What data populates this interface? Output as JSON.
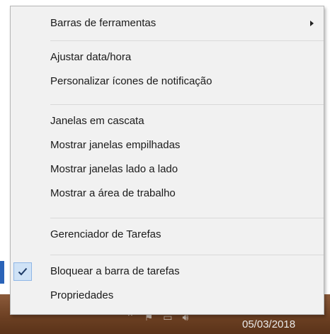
{
  "menu": {
    "items": [
      {
        "label": "Barras de ferramentas",
        "submenu": true
      },
      {
        "label": "Ajustar data/hora"
      },
      {
        "label": "Personalizar ícones de notificação"
      },
      {
        "label": "Janelas em cascata"
      },
      {
        "label": "Mostrar janelas empilhadas"
      },
      {
        "label": "Mostrar janelas lado a lado"
      },
      {
        "label": "Mostrar a área de trabalho"
      },
      {
        "label": "Gerenciador de Tarefas"
      },
      {
        "label": "Bloquear a barra de tarefas",
        "checked": true
      },
      {
        "label": "Propriedades"
      }
    ]
  },
  "taskbar": {
    "date": "05/03/2018"
  },
  "icons": {
    "submenu_arrow": "chevron-right-icon",
    "checkmark": "checkmark-icon"
  },
  "colors": {
    "menu_background": "#f1f1f1",
    "check_highlight": "#cfe2f6",
    "taskbar": "#6b3f22"
  }
}
